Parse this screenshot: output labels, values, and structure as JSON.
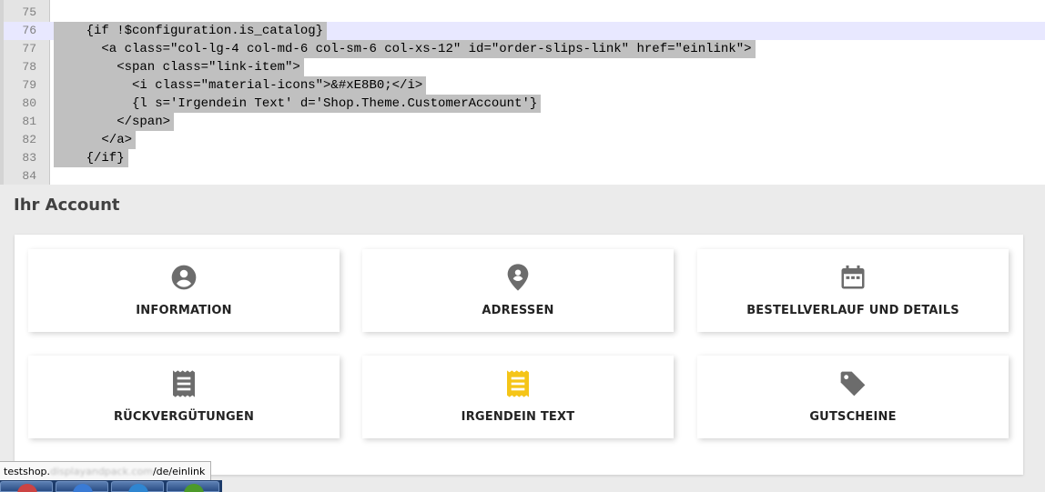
{
  "editor": {
    "lines": [
      {
        "n": "75",
        "text": "",
        "indent": 0
      },
      {
        "n": "76",
        "text": "{if !$configuration.is_catalog}",
        "indent": 4,
        "current": true
      },
      {
        "n": "77",
        "text": "<a class=\"col-lg-4 col-md-6 col-sm-6 col-xs-12\" id=\"order-slips-link\" href=\"einlink\">",
        "indent": 6
      },
      {
        "n": "78",
        "text": "<span class=\"link-item\">",
        "indent": 8
      },
      {
        "n": "79",
        "text": "<i class=\"material-icons\">&#xE8B0;</i>",
        "indent": 10
      },
      {
        "n": "80",
        "text": "{l s='Irgendein Text' d='Shop.Theme.CustomerAccount'}",
        "indent": 10
      },
      {
        "n": "81",
        "text": "</span>",
        "indent": 8
      },
      {
        "n": "82",
        "text": "</a>",
        "indent": 6
      },
      {
        "n": "83",
        "text": "{/if}",
        "indent": 4
      },
      {
        "n": "84",
        "text": "",
        "indent": 0
      }
    ]
  },
  "account": {
    "title": "Ihr Account",
    "cards": [
      {
        "label": "INFORMATION",
        "icon": "account-circle-icon",
        "color": "#6c6c6c"
      },
      {
        "label": "ADRESSEN",
        "icon": "location-pin-icon",
        "color": "#6c6c6c"
      },
      {
        "label": "BESTELLVERLAUF UND DETAILS",
        "icon": "calendar-icon",
        "color": "#6c6c6c"
      },
      {
        "label": "RÜCKVERGÜTUNGEN",
        "icon": "receipt-icon",
        "color": "#6c6c6c"
      },
      {
        "label": "IRGENDEIN TEXT",
        "icon": "receipt-icon",
        "color": "#f5c518"
      },
      {
        "label": "GUTSCHEINE",
        "icon": "tag-icon",
        "color": "#6c6c6c"
      }
    ]
  },
  "statusbar": {
    "url_prefix": "testshop.",
    "url_hidden": "displayandpack.com",
    "url_suffix": "/de/einlink"
  }
}
